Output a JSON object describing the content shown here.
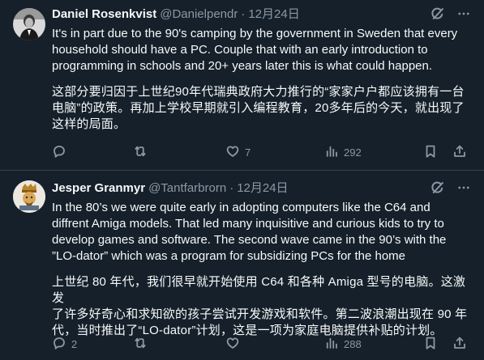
{
  "tweets": [
    {
      "name": "Daniel Rosenkvist",
      "handle": "@Danielpendr",
      "separator": "·",
      "date": "12月24日",
      "text_en": "It's in part due to the 90's camping by the government in Sweden that every\nhousehold should have a PC. Couple that with an early introduction to\nprogramming in schools and 20+ years later this is what could happen.",
      "text_zh": "这部分要归因于上世纪90年代瑞典政府大力推行的“家家户户都应该拥有一台\n电脑”的政策。再加上学校早期就引入编程教育，20多年后的今天，就出现了\n这样的局面。",
      "replies": "",
      "retweets": "",
      "likes": "7",
      "views": "292"
    },
    {
      "name": "Jesper Granmyr",
      "handle": "@Tantfarbrorn",
      "separator": "·",
      "date": "12月24日",
      "text_en": "In the 80’s we were quite early in adopting computers like the C64 and\ndiffrent Amiga models. That led many inquisitive and curious kids to try to\ndevelop games and software. The second wave came in the 90’s with the\n”LO-dator” which was a program for subsidizing PCs for the home",
      "text_zh": "上世纪 80 年代，我们很早就开始使用 C64 和各种 Amiga 型号的电脑。这激发\n了许多好奇心和求知欲的孩子尝试开发游戏和软件。第二波浪潮出现在 90 年\n代，当时推出了“LO-dator”计划，这是一项为家庭电脑提供补贴的计划。",
      "replies": "2",
      "retweets": "",
      "likes": "",
      "views": "288"
    }
  ],
  "icons": {
    "reply": "reply-icon",
    "retweet": "retweet-icon",
    "like": "like-icon",
    "views": "views-icon",
    "bookmark": "bookmark-icon",
    "share": "share-icon",
    "grok": "grok-icon",
    "more": "more-icon"
  },
  "colors": {
    "background": "#15202b",
    "text": "#f7f9f9",
    "secondary": "#8b98a5",
    "divider": "#38444d"
  }
}
